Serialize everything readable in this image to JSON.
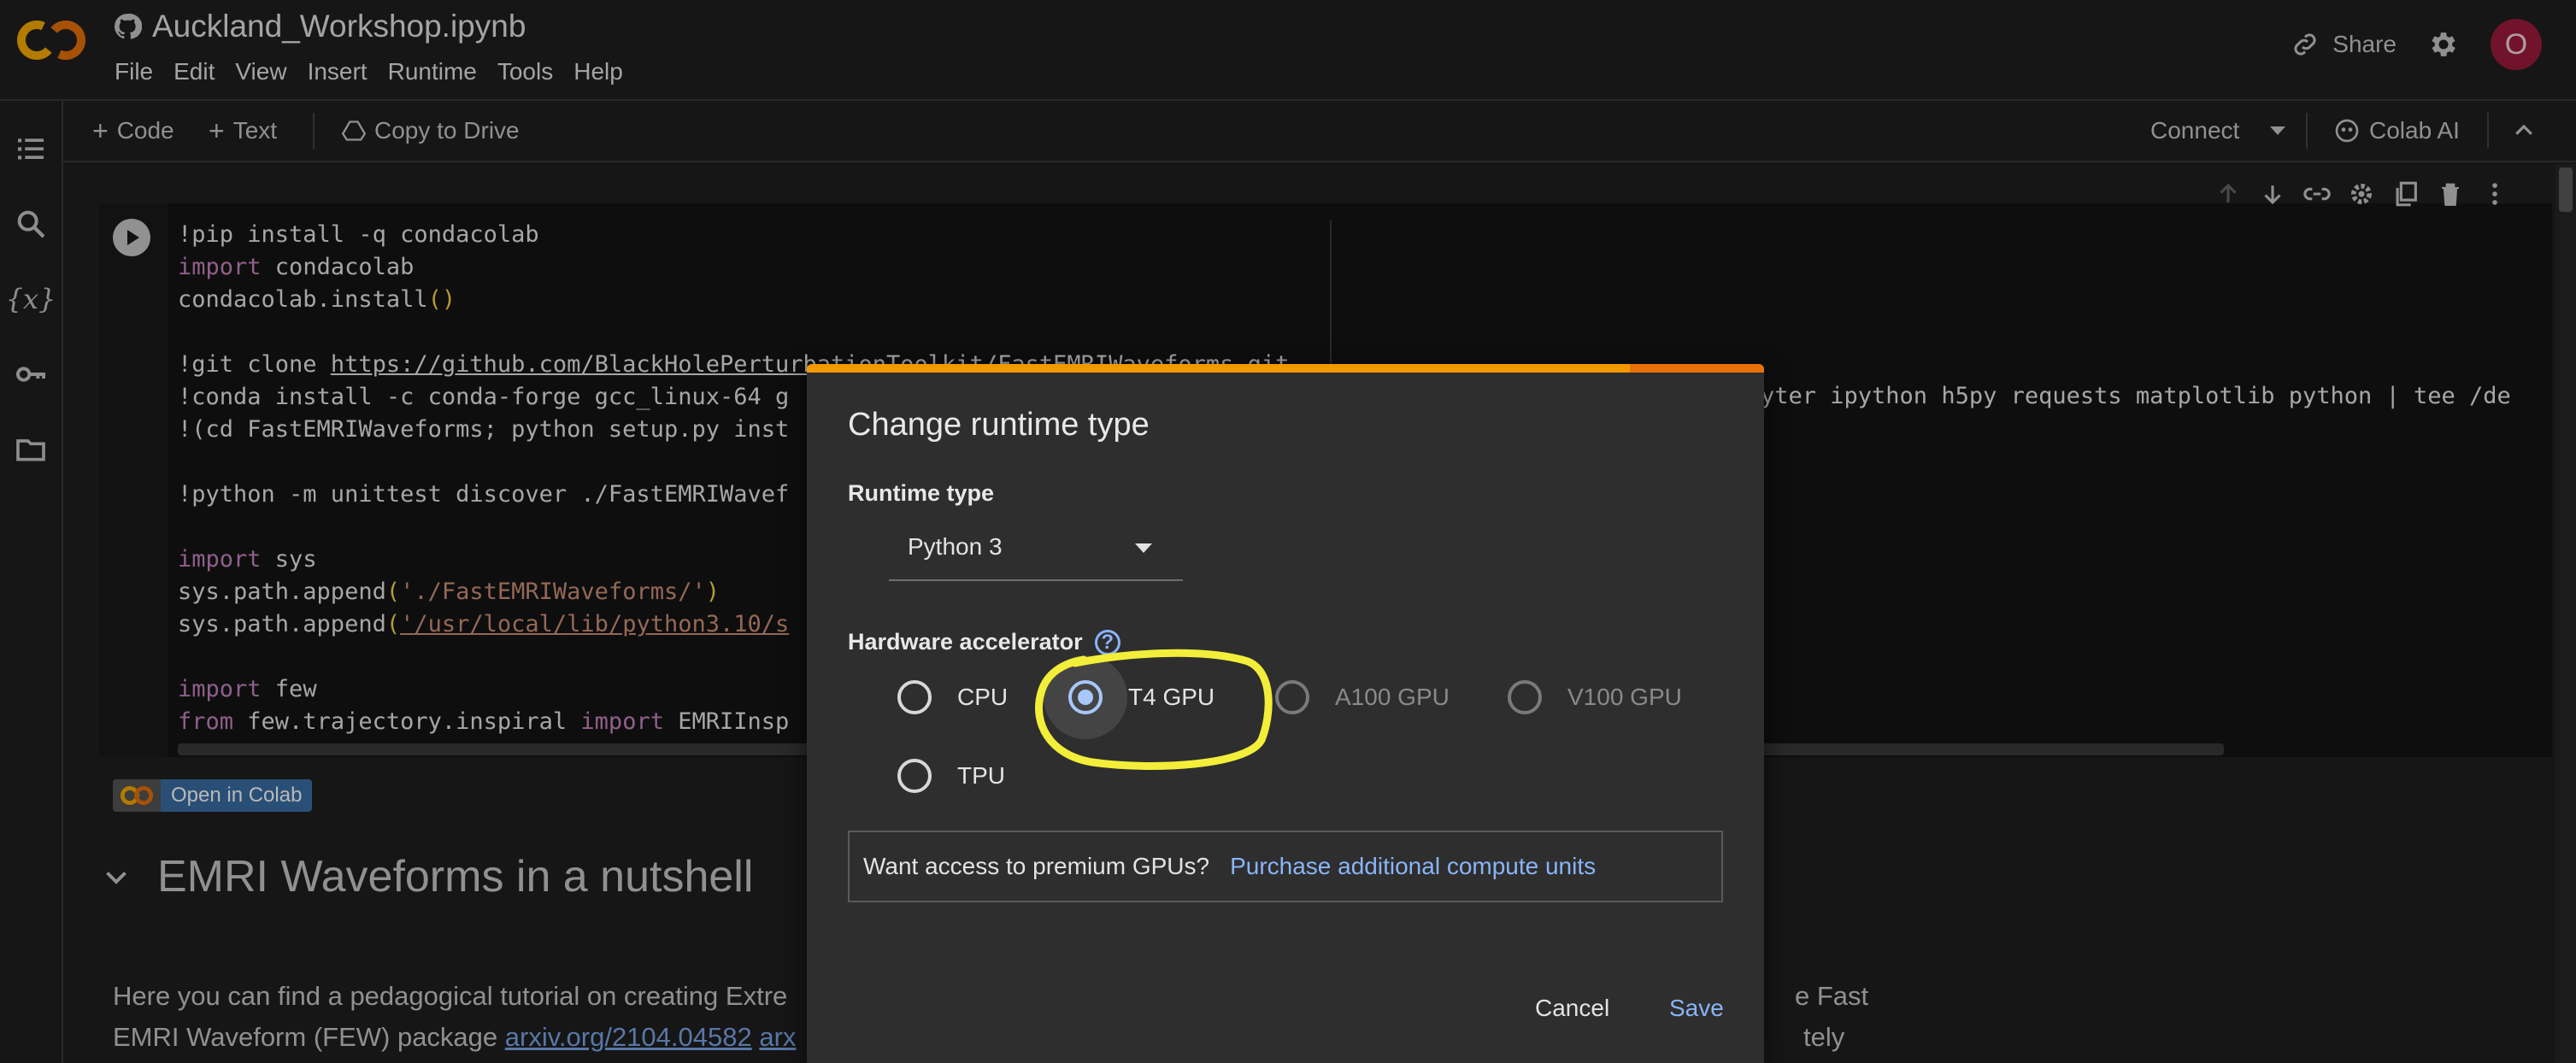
{
  "header": {
    "title": "Auckland_Workshop.ipynb",
    "menu": [
      "File",
      "Edit",
      "View",
      "Insert",
      "Runtime",
      "Tools",
      "Help"
    ],
    "share_label": "Share",
    "avatar_initial": "O"
  },
  "toolbar": {
    "code_label": "Code",
    "text_label": "Text",
    "copy_label": "Copy to Drive",
    "connect_label": "Connect",
    "colab_ai_label": "Colab AI"
  },
  "cell": {
    "lines": [
      "!pip install -q condacolab",
      "import condacolab",
      "condacolab.install()",
      "",
      "!git clone https://github.com/BlackHolePerturbationToolkit/FastEMRIWaveforms.git",
      "!conda install -c conda-forge gcc_linux-64 g",
      "!(cd FastEMRIWaveforms; python setup.py inst",
      "",
      "!python -m unittest discover ./FastEMRIWavef",
      "",
      "import sys",
      "sys.path.append('./FastEMRIWaveforms/')",
      "sys.path.append('/usr/local/lib/python3.10/s",
      "",
      "import few",
      "from few.trajectory.inspiral import EMRIInsp"
    ],
    "right_fragment": "yter ipython h5py requests matplotlib python | tee /de"
  },
  "badge": {
    "label": "Open in Colab"
  },
  "section": {
    "title": "EMRI Waveforms in a nutshell"
  },
  "paragraph": {
    "line1_start": "Here you can find a pedagogical tutorial on creating Extre",
    "line1_end": "e Fast",
    "line2_start": "EMRI Waveform (FEW) package ",
    "link1": "arxiv.org/2104.04582",
    "link2": "arx",
    "line2_end": "tely"
  },
  "dialog": {
    "title": "Change runtime type",
    "runtime_label": "Runtime type",
    "runtime_value": "Python 3",
    "hardware_label": "Hardware accelerator",
    "help_glyph": "?",
    "options": [
      {
        "label": "CPU",
        "state": "unchecked"
      },
      {
        "label": "T4 GPU",
        "state": "checked"
      },
      {
        "label": "A100 GPU",
        "state": "disabled"
      },
      {
        "label": "V100 GPU",
        "state": "disabled"
      },
      {
        "label": "TPU",
        "state": "unchecked"
      }
    ],
    "premium_text": "Want access to premium GPUs?",
    "premium_link": "Purchase additional compute units",
    "cancel_label": "Cancel",
    "save_label": "Save"
  },
  "colors": {
    "accent_orange": "#f29900",
    "link_blue": "#8ab4f8",
    "highlight_yellow": "#f2ee3a",
    "avatar_bg": "#9b1b3c"
  }
}
